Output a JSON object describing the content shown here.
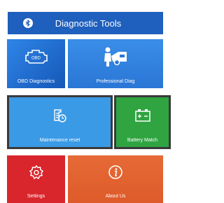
{
  "header": {
    "title": "Diagnostic Tools",
    "icon": "bluetooth-icon"
  },
  "tiles": {
    "obd": {
      "label": "OBD Diagnostics",
      "icon": "obd-engine-icon",
      "color": "#2a72d4"
    },
    "professional": {
      "label": "Professional Diag",
      "icon": "mechanic-car-icon",
      "color": "#3186e3"
    },
    "maintenance": {
      "label": "Maintenance reset",
      "icon": "maintenance-document-icon",
      "color": "#3a9ae6"
    },
    "battery": {
      "label": "Battery Match",
      "icon": "battery-icon",
      "color": "#2fa441"
    },
    "settings": {
      "label": "Settings",
      "icon": "gear-icon",
      "color": "#d8262c"
    },
    "about": {
      "label": "About Us",
      "icon": "info-icon",
      "color": "#e0612f"
    }
  }
}
